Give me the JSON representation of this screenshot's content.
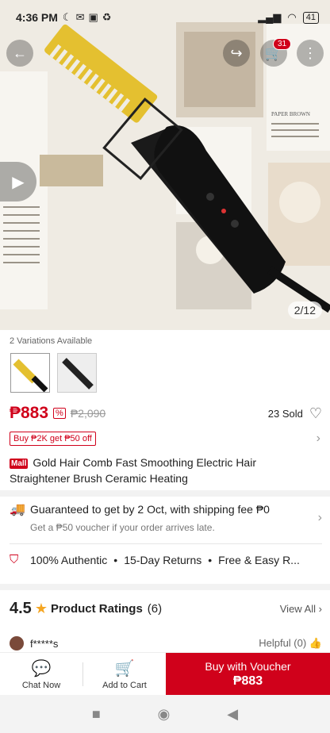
{
  "status_bar": {
    "time": "4:36 PM",
    "battery": "41"
  },
  "hero": {
    "image_counter": "2/12",
    "cart_badge": "31",
    "page_text": "PAPER BROWN"
  },
  "variations": {
    "label": "2 Variations Available"
  },
  "price": {
    "current": "₱883",
    "original": "₱2,090",
    "sold": "23 Sold"
  },
  "promo": {
    "label": "Buy ₱2K get ₱50 off"
  },
  "product": {
    "mall_badge": "Mall",
    "title": "Gold Hair Comb Fast Smoothing Electric Hair Straightener Brush Ceramic Heating"
  },
  "shipping": {
    "headline": "Guaranteed to get by 2 Oct, with shipping fee ₱0",
    "subtext": "Get a ₱50 voucher if your order arrives late."
  },
  "assurance": {
    "items": [
      "100% Authentic",
      "15-Day Returns",
      "Free & Easy R..."
    ]
  },
  "ratings": {
    "score": "4.5",
    "title": "Product Ratings",
    "count": "(6)",
    "view_all": "View All"
  },
  "review": {
    "user": "f*****s",
    "helpful": "Helpful (0)"
  },
  "bottom_bar": {
    "chat_label": "Chat Now",
    "cart_label": "Add to Cart",
    "buy_label": "Buy with Voucher",
    "buy_price": "₱883"
  },
  "colors": {
    "accent": "#d0011b",
    "teal": "#26aa99",
    "star": "#f5a623"
  }
}
